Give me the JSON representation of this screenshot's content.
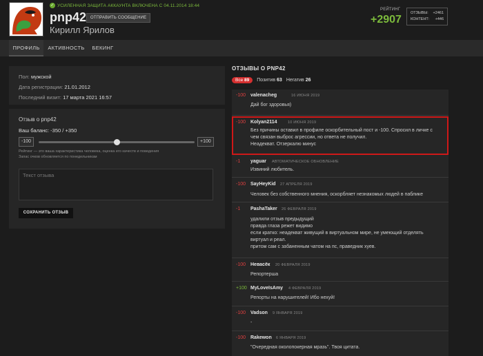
{
  "header": {
    "security_note": "УСИЛЕННАЯ ЗАЩИТА АККАУНТА ВКЛЮЧЕНА С 04.11.2014 18:44",
    "username": "pnp42",
    "send_message": "ОТПРАВИТЬ СООБЩЕНИЕ",
    "real_name": "Кирилл Ярилов",
    "rating_label": "РЕЙТИНГ",
    "rating_value": "+2907",
    "stats": {
      "reviews_label": "ОТЗЫВЫ:",
      "reviews_value": "+2461",
      "content_label": "КОНТЕНТ:",
      "content_value": "+446"
    }
  },
  "tabs": [
    "ПРОФИЛЬ",
    "АКТИВНОСТЬ",
    "БЕКИНГ"
  ],
  "info": {
    "gender_label": "Пол:",
    "gender_value": "мужской",
    "reg_label": "Дата регистрации:",
    "reg_value": "21.01.2012",
    "visit_label": "Последний визит:",
    "visit_value": "17 марта 2021 16:57"
  },
  "review_form": {
    "title": "Отзыв о pnp42",
    "balance": "Ваш баланс: -350 / +350",
    "min_label": "-100",
    "max_label": "+100",
    "slider_value": 0.5,
    "hint_line1": "Рейтинг — это ваша характеристика человека, оценка его качеств и поведения",
    "hint_line2": "Запас очков обновляется по понедельникам",
    "placeholder": "Текст отзыва",
    "save": "СОХРАНИТЬ ОТЗЫВ"
  },
  "reviews_header": {
    "title": "ОТЗЫВЫ О PNP42",
    "all_label": "Все",
    "all_count": "89",
    "pos_label": "Позитив",
    "pos_count": "63",
    "neg_label": "Негатив",
    "neg_count": "26"
  },
  "reviews": [
    {
      "score": "-100",
      "author": "valenacheg",
      "date": "16 ИЮНЯ 2019",
      "lines": [
        "Дай бог здоровья)"
      ]
    },
    {
      "score": "-100",
      "author": "Kolyan2114",
      "date": "10 ИЮНЯ 2019",
      "lines": [
        "Без причины оставил в профиле оскорбительный пост и -100. Спросил в личке с",
        "чем связан выброс агрессии, но ответа не получил.",
        "Неадекват. Отзеркалю минус"
      ]
    },
    {
      "score": "-1",
      "author": "yaguar",
      "date": "АВТОМАТИЧЕСКОЕ ОБНОВЛЕНИЕ",
      "lines": [
        "Извиний любитель."
      ]
    },
    {
      "score": "-100",
      "author": "SayHeyKid",
      "date": "27 АПРЕЛЯ 2019",
      "lines": [
        "Человек без собственного мнения, оскорбляет незнакомых людей в паблике"
      ]
    },
    {
      "score": "-1",
      "author": "PashaTaker",
      "date": "26 ФЕВРАЛЯ 2019",
      "lines": [
        "удалили отзыв предыдущий",
        "правда глаза режет видимо",
        "если кратко: неадекват живущий в виртуальном мире, не умеющий отделять",
        "виртуал и реал.",
        "притом сам с забаненным чатом на пс, праведник хуев."
      ]
    },
    {
      "score": "-100",
      "author": "Невасёк",
      "date": "20 ФЕВРАЛЯ 2019",
      "lines": [
        "Репортерша"
      ]
    },
    {
      "score": "+100",
      "author": "MyLoveIsAmy",
      "date": "4 ФЕВРАЛЯ 2019",
      "lines": [
        "Репорты на нарушителей! Ибо нехуй!"
      ]
    },
    {
      "score": "-100",
      "author": "Vadson",
      "date": "9 ЯНВАРЯ 2019",
      "lines": [
        "-"
      ]
    },
    {
      "score": "-100",
      "author": "Rakewon",
      "date": "6 ЯНВАРЯ 2019",
      "lines": [
        "\"Очередная околопокерная мразь\". Твоя цитата."
      ]
    }
  ],
  "colors": {
    "accent_green": "#7cbb3c",
    "negative_red": "#e04040",
    "highlight_border": "#d01818"
  }
}
